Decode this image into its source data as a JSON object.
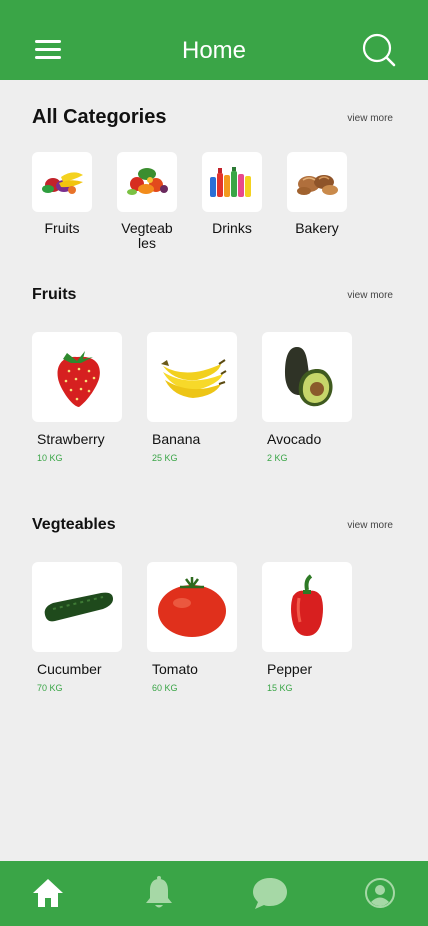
{
  "header": {
    "title": "Home"
  },
  "categories": {
    "title": "All Categories",
    "view_more": "view more",
    "items": [
      {
        "label": "Fruits",
        "icon": "fruits-basket-icon"
      },
      {
        "label": "Vegteab les",
        "icon": "vegetables-basket-icon"
      },
      {
        "label": "Drinks",
        "icon": "drinks-bottles-icon"
      },
      {
        "label": "Bakery",
        "icon": "bakery-bread-icon"
      }
    ]
  },
  "fruits": {
    "title": "Fruits",
    "view_more": "view more",
    "items": [
      {
        "name": "Strawberry",
        "weight": "10 KG"
      },
      {
        "name": "Banana",
        "weight": "25 KG"
      },
      {
        "name": "Avocado",
        "weight": "2 KG"
      }
    ]
  },
  "vegetables": {
    "title": "Vegteables",
    "view_more": "view more",
    "items": [
      {
        "name": "Cucumber",
        "weight": "70 KG"
      },
      {
        "name": "Tomato",
        "weight": "60 KG"
      },
      {
        "name": "Pepper",
        "weight": "15 KG"
      }
    ]
  },
  "bottom_nav": [
    {
      "name": "home",
      "icon": "home-icon",
      "active": true
    },
    {
      "name": "notifications",
      "icon": "bell-icon",
      "active": false
    },
    {
      "name": "messages",
      "icon": "chat-bubble-icon",
      "active": false
    },
    {
      "name": "profile",
      "icon": "user-profile-icon",
      "active": false
    }
  ],
  "colors": {
    "primary": "#3aa547",
    "background": "#eeeeee",
    "tile": "#ffffff",
    "weight_text": "#3aa547"
  }
}
